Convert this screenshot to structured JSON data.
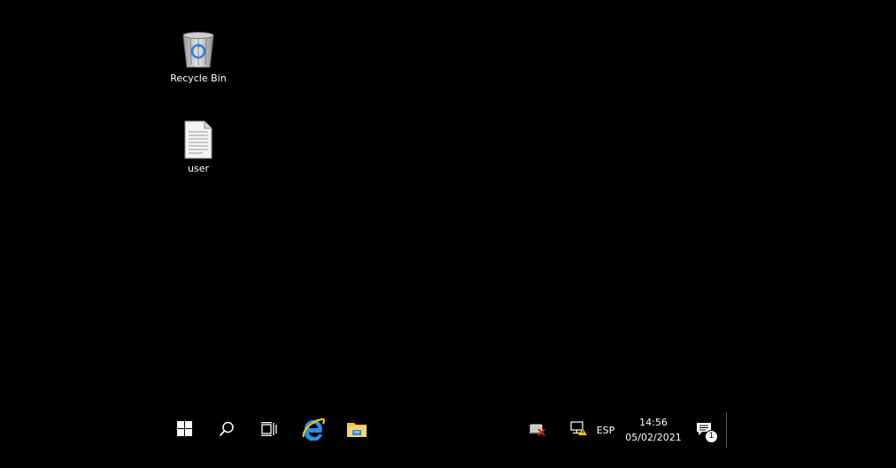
{
  "desktop": {
    "background_color": "#000000",
    "icons": [
      {
        "label": "Recycle Bin",
        "icon": "recycle-bin-icon"
      },
      {
        "label": "user",
        "icon": "text-document-icon"
      }
    ]
  },
  "taskbar": {
    "start": {
      "icon": "windows-logo-icon"
    },
    "search": {
      "icon": "search-icon"
    },
    "task_view": {
      "icon": "task-view-icon"
    },
    "pinned": [
      {
        "name": "Internet Explorer",
        "icon": "internet-explorer-icon"
      },
      {
        "name": "File Explorer",
        "icon": "file-explorer-icon"
      }
    ],
    "tray": {
      "network_error_icon": "network-disconnected-icon",
      "network_warning_icon": "network-warning-icon",
      "language": "ESP",
      "time": "14:56",
      "date": "05/02/2021",
      "notification_count": "1"
    }
  }
}
